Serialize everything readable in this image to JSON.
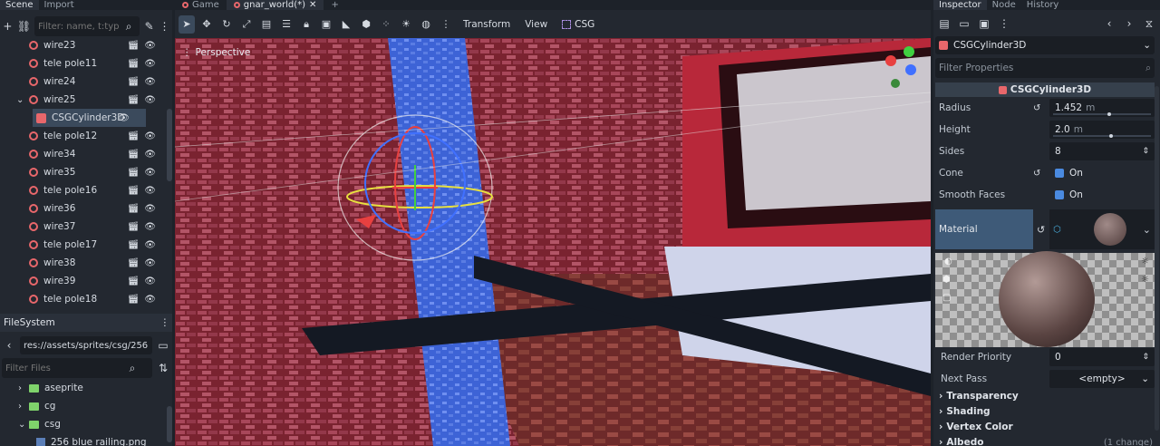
{
  "left_tabs": {
    "scene": "Scene",
    "import": "Import"
  },
  "scene_filter_placeholder": "Filter: name, t:typ",
  "scene_tree": [
    {
      "label": "wire23",
      "kind": "node",
      "indent": 1
    },
    {
      "label": "tele pole11",
      "kind": "node",
      "indent": 1
    },
    {
      "label": "wire24",
      "kind": "node",
      "indent": 1
    },
    {
      "label": "wire25",
      "kind": "node",
      "indent": 1,
      "expanded": true
    },
    {
      "label": "CSGCylinder3D",
      "kind": "csg",
      "indent": 2,
      "selected": true
    },
    {
      "label": "tele pole12",
      "kind": "node",
      "indent": 1
    },
    {
      "label": "wire34",
      "kind": "node",
      "indent": 1
    },
    {
      "label": "wire35",
      "kind": "node",
      "indent": 1
    },
    {
      "label": "tele pole16",
      "kind": "node",
      "indent": 1
    },
    {
      "label": "wire36",
      "kind": "node",
      "indent": 1
    },
    {
      "label": "wire37",
      "kind": "node",
      "indent": 1
    },
    {
      "label": "tele pole17",
      "kind": "node",
      "indent": 1
    },
    {
      "label": "wire38",
      "kind": "node",
      "indent": 1
    },
    {
      "label": "wire39",
      "kind": "node",
      "indent": 1
    },
    {
      "label": "tele pole18",
      "kind": "node",
      "indent": 1
    }
  ],
  "filesystem": {
    "title": "FileSystem",
    "path": "res://assets/sprites/csg/256",
    "filter_placeholder": "Filter Files",
    "items": [
      {
        "label": "aseprite",
        "kind": "folder",
        "expanded": false
      },
      {
        "label": "cg",
        "kind": "folder",
        "expanded": false
      },
      {
        "label": "csg",
        "kind": "folder",
        "expanded": true
      },
      {
        "label": "256 blue railing.png",
        "kind": "file"
      }
    ]
  },
  "doc_tabs": [
    {
      "label": "Game",
      "active": false
    },
    {
      "label": "gnar_world(*)",
      "active": true
    }
  ],
  "viewport_menus": {
    "transform": "Transform",
    "view": "View",
    "csg": "CSG"
  },
  "viewport_label": "Perspective",
  "inspector": {
    "tabs": {
      "inspector": "Inspector",
      "node": "Node",
      "history": "History"
    },
    "object": "CSGCylinder3D",
    "filter_placeholder": "Filter Properties",
    "section": "CSGCylinder3D",
    "props": {
      "radius": {
        "label": "Radius",
        "value": "1.452",
        "unit": "m"
      },
      "height": {
        "label": "Height",
        "value": "2.0",
        "unit": "m"
      },
      "sides": {
        "label": "Sides",
        "value": "8"
      },
      "cone": {
        "label": "Cone",
        "value": "On"
      },
      "smooth_faces": {
        "label": "Smooth Faces",
        "value": "On"
      },
      "material": {
        "label": "Material"
      },
      "render_priority": {
        "label": "Render Priority",
        "value": "0"
      },
      "next_pass": {
        "label": "Next Pass",
        "value": "<empty>"
      }
    },
    "groups": [
      "Transparency",
      "Shading",
      "Vertex Color",
      "Albedo"
    ],
    "change_note": "(1 change)"
  },
  "colors": {
    "accent": "#3e5a78",
    "node_icon": "#e8676b",
    "folder": "#7fd36b",
    "check": "#4a8ae0"
  }
}
